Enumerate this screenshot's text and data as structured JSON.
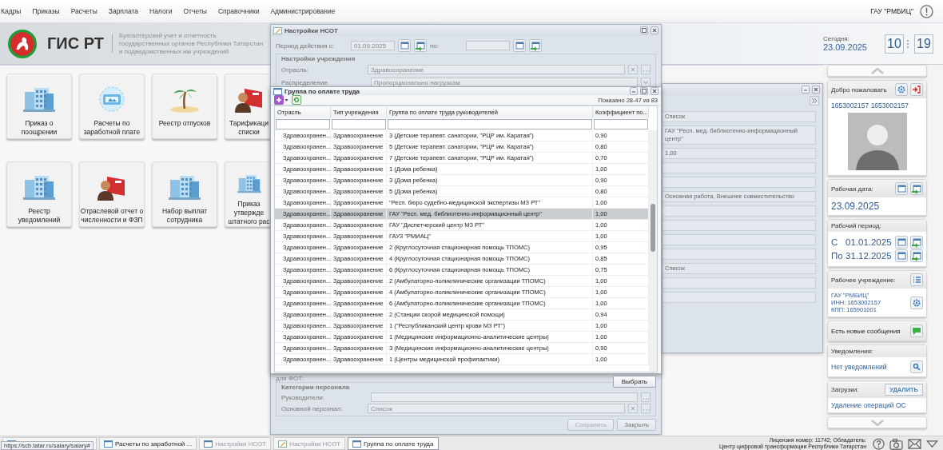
{
  "menu": [
    "Кадры",
    "Приказы",
    "Расчеты",
    "Зарплата",
    "Налоги",
    "Отчеты",
    "Справочники",
    "Администрирование"
  ],
  "organization": "ГАУ \"РМБИЦ\"",
  "header": {
    "title": "ГИС РТ",
    "subtitle": [
      "Бухгалтерский учет и отчетность",
      "государственных органов Республики Татарстан",
      "и подведомственных им учреждений"
    ],
    "today_label": "Сегодня:",
    "today": "23.09.2025",
    "hours": "10",
    "minutes": "19"
  },
  "tiles": [
    {
      "label": "Приказ о поощрении",
      "kind": "building",
      "partial": false
    },
    {
      "label": "Расчеты по заработной плате",
      "kind": "card",
      "partial": false
    },
    {
      "label": "Реестр отпусков",
      "kind": "palm",
      "partial": false
    },
    {
      "label": "Тарификаци списки",
      "kind": "book",
      "partial": true
    },
    {
      "label": "Реестр уведомлений",
      "kind": "building",
      "partial": false
    },
    {
      "label": "Отраслевой отчет о численности и ФЗП",
      "kind": "book",
      "partial": false
    },
    {
      "label": "Набор выплат сотрудника",
      "kind": "building",
      "partial": false
    },
    {
      "label": "Приказ утвержде штатного рас",
      "kind": "building",
      "partial": true
    }
  ],
  "nsot_window": {
    "title": "Настройки НСОТ",
    "period_label": "Период действия с:",
    "period_from": "01.09.2025",
    "period_to_label": "по:",
    "settings_legend": "Настройки учреждения",
    "fields": [
      {
        "label": "Отрасль:",
        "value": "Здравоохранение",
        "kind": "lookup"
      },
      {
        "label": "Распределение",
        "value": "Пропорционально нагрузкам",
        "kind": "select"
      }
    ],
    "fot_label": "для ФОТ:",
    "staff_legend": "Категории персонала",
    "staff_fields": [
      {
        "label": "Руководители:",
        "kind": "list"
      },
      {
        "label": "Основной персонал:",
        "value": "Список",
        "kind": "lookup"
      }
    ],
    "buttons": [
      {
        "label": "Сохранить",
        "disabled": true
      },
      {
        "label": "Закрыть",
        "disabled": false
      }
    ]
  },
  "right_window": {
    "fields": [
      {
        "kind": "text",
        "value": "Список"
      },
      {
        "kind": "text",
        "value": "ГАУ \"Респ. мед. библиотечно-информационный центр\""
      },
      {
        "kind": "text",
        "value": "1,00"
      },
      {
        "kind": "empty"
      },
      {
        "kind": "empty"
      },
      {
        "kind": "text",
        "value": "Основная работа, Внешнее совместительство"
      },
      {
        "kind": "empty"
      },
      {
        "kind": "empty"
      },
      {
        "kind": "empty"
      },
      {
        "kind": "empty"
      },
      {
        "kind": "text",
        "value": "Список"
      },
      {
        "kind": "empty"
      },
      {
        "kind": "empty"
      }
    ]
  },
  "group_dialog": {
    "title": "Группа по оплате труда",
    "shown": "Показано 28-47 из 83",
    "columns": [
      "Отрасль",
      "Тип учреждения",
      "Группа по оплате труда руководителей",
      "Коэффициент по..."
    ],
    "rows": [
      {
        "industry": "Здравоохранен...",
        "type": "Здравоохранение",
        "group": "3 (Детские терапевт. санатории, \"РЦР им. Каратая\")",
        "coef": "0,90",
        "selected": false
      },
      {
        "industry": "Здравоохранен...",
        "type": "Здравоохранение",
        "group": "5 (Детские терапевт. санатории, \"РЦР им. Каратая\")",
        "coef": "0,80",
        "selected": false
      },
      {
        "industry": "Здравоохранен...",
        "type": "Здравоохранение",
        "group": "7 (Детские терапевт. санатории, \"РЦР им. Каратая\")",
        "coef": "0,70",
        "selected": false
      },
      {
        "industry": "Здравоохранен...",
        "type": "Здравоохранение",
        "group": "1 (Дома ребенка)",
        "coef": "1,00",
        "selected": false
      },
      {
        "industry": "Здравоохранен...",
        "type": "Здравоохранение",
        "group": "3 (Дома ребенка)",
        "coef": "0,90",
        "selected": false
      },
      {
        "industry": "Здравоохранен...",
        "type": "Здравоохранение",
        "group": "5 (Дома ребенка)",
        "coef": "0,80",
        "selected": false
      },
      {
        "industry": "Здравоохранен...",
        "type": "Здравоохранение",
        "group": "\"Респ. бюро судебно-медицинской экспертизы МЗ РТ\"",
        "coef": "1,00",
        "selected": false
      },
      {
        "industry": "Здравоохранен...",
        "type": "Здравоохранение",
        "group": "ГАУ \"Респ. мед. библиотечно-информационный центр\"",
        "coef": "1,00",
        "selected": true
      },
      {
        "industry": "Здравоохранен...",
        "type": "Здравоохранение",
        "group": "ГАУ \"Диспетчерский центр МЗ РТ\"",
        "coef": "1,00",
        "selected": false
      },
      {
        "industry": "Здравоохранен...",
        "type": "Здравоохранение",
        "group": "ГАУЗ \"РМИАЦ\"",
        "coef": "1,00",
        "selected": false
      },
      {
        "industry": "Здравоохранен...",
        "type": "Здравоохранение",
        "group": "2 (Круглосуточная стационарная помощь ТПОМС)",
        "coef": "0,95",
        "selected": false
      },
      {
        "industry": "Здравоохранен...",
        "type": "Здравоохранение",
        "group": "4 (Круглосуточная стационарная помощь ТПОМС)",
        "coef": "0,85",
        "selected": false
      },
      {
        "industry": "Здравоохранен...",
        "type": "Здравоохранение",
        "group": "6 (Круглосуточная стационарная помощь ТПОМС)",
        "coef": "0,75",
        "selected": false
      },
      {
        "industry": "Здравоохранен...",
        "type": "Здравоохранение",
        "group": "2 (Амбулаторно-поликлинические организации ТПОМС)",
        "coef": "1,00",
        "selected": false
      },
      {
        "industry": "Здравоохранен...",
        "type": "Здравоохранение",
        "group": "4 (Амбулаторно-поликлинические организации ТПОМС)",
        "coef": "1,00",
        "selected": false
      },
      {
        "industry": "Здравоохранен...",
        "type": "Здравоохранение",
        "group": "6 (Амбулаторно-поликлинические организации ТПОМС)",
        "coef": "1,00",
        "selected": false
      },
      {
        "industry": "Здравоохранен...",
        "type": "Здравоохранение",
        "group": "2 (Станции скорой медицинской помощи)",
        "coef": "0,94",
        "selected": false
      },
      {
        "industry": "Здравоохранен...",
        "type": "Здравоохранение",
        "group": "1 (\"Республиканский центр крови МЗ РТ\")",
        "coef": "1,00",
        "selected": false
      },
      {
        "industry": "Здравоохранен...",
        "type": "Здравоохранение",
        "group": "1 (Медицинские информационно-аналитические центры)",
        "coef": "1,00",
        "selected": false
      },
      {
        "industry": "Здравоохранен...",
        "type": "Здравоохранение",
        "group": "3 (Медицинские информационно-аналитические центры)",
        "coef": "0,90",
        "selected": false
      },
      {
        "industry": "Здравоохранен...",
        "type": "Здравоохранение",
        "group": "1 (Центры медицинской профилактики)",
        "coef": "1,00",
        "selected": false
      }
    ],
    "select_button": "Выбрать"
  },
  "sidebar": {
    "welcome_title": "Добро пожаловать",
    "user": "1653002157 1653002157",
    "work_date_title": "Рабочая дата:",
    "work_date": "23.09.2025",
    "period_title": "Рабочий период:",
    "period": [
      {
        "prefix": "С",
        "date": "01.01.2025"
      },
      {
        "prefix": "По",
        "date": "31.12.2025"
      }
    ],
    "institution_title": "Рабочее учреждение:",
    "institution": [
      "ГАУ \"РМБИЦ\"",
      "ИНН: 1653002157",
      "КПП: 165901001"
    ],
    "messages": "Есть новые сообщения",
    "notifications_title": "Уведомления:",
    "notifications": "Нет уведомлений",
    "downloads_title": "Загрузки:",
    "delete_button": "УДАЛИТЬ",
    "downloads": [
      "Удаление операций ОС"
    ]
  },
  "taskbar": {
    "tooltip": "https://scb.tatar.ru/salary/salary#",
    "tasks": [
      {
        "kind": "window",
        "selected": false
      },
      {
        "label": "Расчеты по заработной ...",
        "kind": "window",
        "selected": false,
        "disabled": false
      },
      {
        "label": "Настройки НСОТ",
        "kind": "window",
        "selected": false,
        "disabled": true
      },
      {
        "label": "Настройки НСОТ",
        "kind": "edit",
        "selected": false,
        "disabled": true
      },
      {
        "label": "Группа по оплате труда",
        "kind": "window",
        "selected": true,
        "disabled": false
      }
    ]
  },
  "license": [
    "Лицензия номер: 11742; Обладатель:",
    "Центр цифровой трансформации Республики Татарстан"
  ]
}
